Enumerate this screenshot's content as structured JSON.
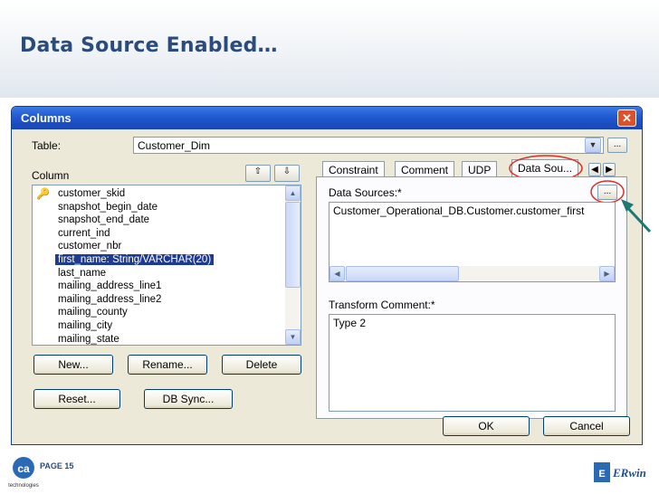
{
  "slide": {
    "title": "Data Source Enabled…",
    "page": "PAGE 15"
  },
  "logos": {
    "ca": "ca",
    "ca_sub": "technologies",
    "erwin": "ERwin"
  },
  "dialog": {
    "title": "Columns",
    "table_label": "Table:",
    "table_value": "Customer_Dim",
    "column_label": "Column",
    "columns": [
      "customer_skid",
      "snapshot_begin_date",
      "snapshot_end_date",
      "current_ind",
      "customer_nbr",
      "first_name: String/VARCHAR(20)",
      "last_name",
      "mailing_address_line1",
      "mailing_address_line2",
      "mailing_county",
      "mailing_city",
      "mailing_state"
    ],
    "selected_index": 5,
    "buttons": {
      "new": "New...",
      "rename": "Rename...",
      "delete": "Delete",
      "reset": "Reset...",
      "dbsync": "DB Sync...",
      "ok": "OK",
      "cancel": "Cancel",
      "ellipsis": "..."
    },
    "tabs": [
      "Constraint",
      "Comment",
      "UDP",
      "Data Sou..."
    ],
    "data_sources_label": "Data Sources:*",
    "data_sources_value": "Customer_Operational_DB.Customer.customer_first",
    "transform_label": "Transform Comment:*",
    "transform_value": "Type 2"
  },
  "colors": {
    "accent": "#1f56cf",
    "highlight_circle": "#d9302b",
    "arrow": "#1a7a73"
  }
}
